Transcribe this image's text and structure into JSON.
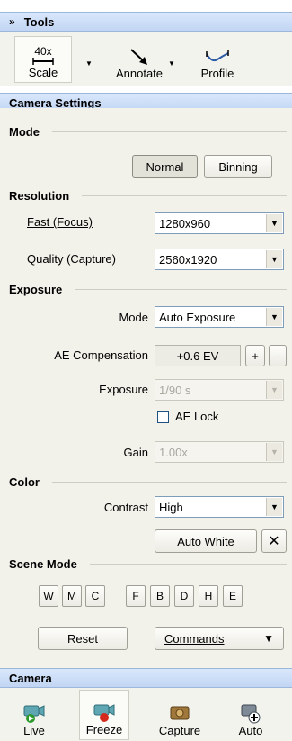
{
  "tools": {
    "header": "Tools",
    "items": [
      {
        "label": "Scale",
        "icon": "scale-ruler-icon",
        "badge": "40x"
      },
      {
        "label": "Annotate",
        "icon": "arrow-pointer-icon"
      },
      {
        "label": "Profile",
        "icon": "profile-line-icon"
      }
    ]
  },
  "camera_settings": {
    "header": "Camera Settings",
    "mode": {
      "title": "Mode",
      "buttons": [
        "Normal",
        "Binning"
      ],
      "selected": "Normal"
    },
    "resolution": {
      "title": "Resolution",
      "fast_label": "Fast (Focus)",
      "fast_value": "1280x960",
      "quality_label": "Quality (Capture)",
      "quality_value": "2560x1920"
    },
    "exposure": {
      "title": "Exposure",
      "mode_label": "Mode",
      "mode_value": "Auto Exposure",
      "ae_comp_label": "AE Compensation",
      "ae_comp_value": "+0.6 EV",
      "plus": "+",
      "minus": "-",
      "exposure_label": "Exposure",
      "exposure_value": "1/90 s",
      "ae_lock_label": "AE Lock",
      "gain_label": "Gain",
      "gain_value": "1.00x"
    },
    "color": {
      "title": "Color",
      "contrast_label": "Contrast",
      "contrast_value": "High",
      "auto_white": "Auto White",
      "close": "✕"
    },
    "scene_mode": {
      "title": "Scene Mode",
      "buttons": [
        "W",
        "M",
        "C",
        "F",
        "B",
        "D",
        "H",
        "E"
      ],
      "reset": "Reset",
      "commands": "Commands"
    }
  },
  "camera": {
    "header": "Camera",
    "items": [
      {
        "label": "Live",
        "icon": "camera-play-icon"
      },
      {
        "label": "Freeze",
        "icon": "camera-record-icon"
      },
      {
        "label": "Capture",
        "icon": "capture-icon"
      },
      {
        "label": "Auto",
        "icon": "auto-capture-icon"
      }
    ]
  },
  "colors": {
    "header_bg": "#c9dbf5",
    "panel_bg": "#f2f1ea",
    "accent_green": "#2b9a2b",
    "accent_red": "#d42a1e"
  }
}
